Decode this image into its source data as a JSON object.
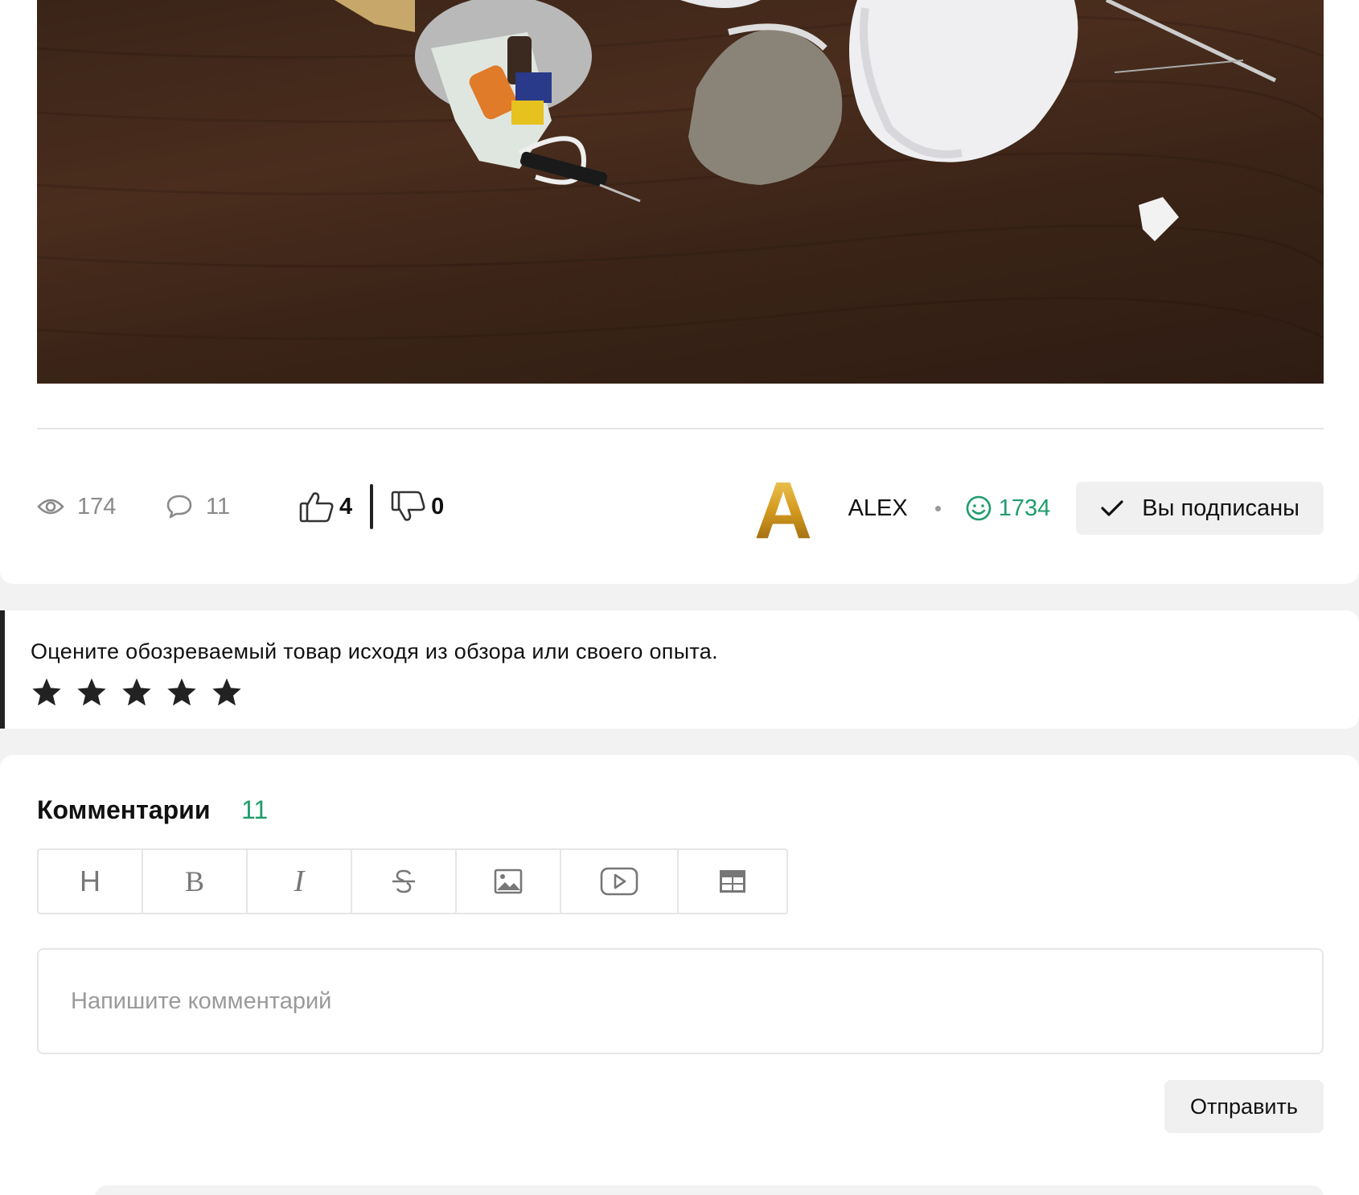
{
  "post": {
    "photo_alt": "",
    "views": "174",
    "comments": "11",
    "likes": "4",
    "dislikes": "0"
  },
  "author": {
    "avatar_letter": "A",
    "name": "ALEX",
    "karma": "1734",
    "subscribe_label": "Вы подписаны"
  },
  "rating": {
    "prompt": "Оцените обозреваемый товар исходя из обзора или своего опыта.",
    "stars_count": 5
  },
  "comments_section": {
    "title": "Комментарии",
    "count": "11",
    "toolbar": {
      "heading": "H",
      "bold": "B",
      "italic": "I"
    },
    "input_placeholder": "Напишите комментарий",
    "send_label": "Отправить"
  },
  "colors": {
    "accent_green": "#1f9d6c",
    "dark": "#222222"
  }
}
